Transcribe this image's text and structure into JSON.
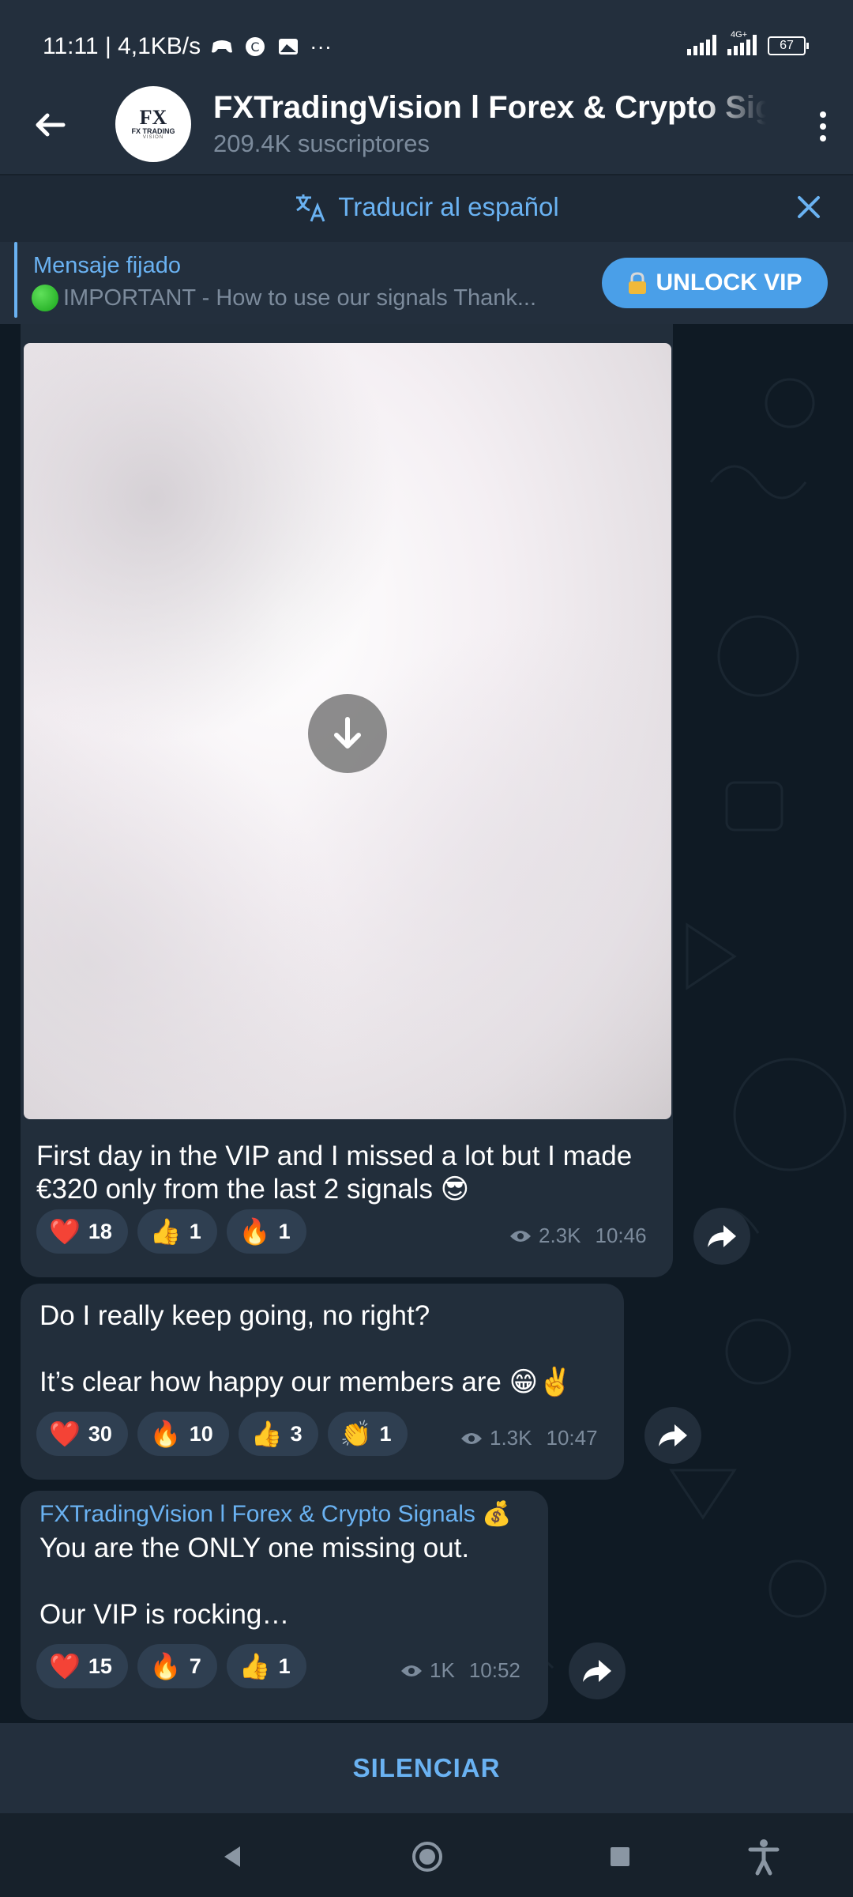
{
  "status_bar": {
    "left_text": "11:11 | 4,1KB/s",
    "network_label": "4G+",
    "battery": "67"
  },
  "header": {
    "title": "FXTradingVision l Forex & Crypto Signals",
    "subtitle": "209.4K suscriptores",
    "avatar_logo_mark": "FX",
    "avatar_logo_text": "FX TRADING",
    "avatar_logo_sub": "VISION"
  },
  "translate_bar": {
    "label": "Traducir al español"
  },
  "pinned": {
    "title": "Mensaje fijado",
    "text": "IMPORTANT - How to use our signals  Thank...",
    "button_label": "UNLOCK VIP"
  },
  "messages": [
    {
      "text_lines": [
        "First day in the VIP and I missed a lot but I made",
        "€320 only from the last 2 signals 😎"
      ],
      "reactions": [
        {
          "emoji": "❤️",
          "count": "18"
        },
        {
          "emoji": "👍",
          "count": "1"
        },
        {
          "emoji": "🔥",
          "count": "1"
        }
      ],
      "views": "2.3K",
      "time": "10:46"
    },
    {
      "text_lines": [
        "Do I really keep going, no right?",
        "",
        "It’s clear how happy our members are 😁✌️"
      ],
      "reactions": [
        {
          "emoji": "❤️",
          "count": "30"
        },
        {
          "emoji": "🔥",
          "count": "10"
        },
        {
          "emoji": "👍",
          "count": "3"
        },
        {
          "emoji": "👏",
          "count": "1"
        }
      ],
      "views": "1.3K",
      "time": "10:47"
    },
    {
      "sender": "FXTradingVision l Forex & Crypto Signals 💰",
      "text_lines": [
        "You are the ONLY one missing out.",
        "",
        "Our VIP is rocking…"
      ],
      "reactions": [
        {
          "emoji": "❤️",
          "count": "15"
        },
        {
          "emoji": "🔥",
          "count": "7"
        },
        {
          "emoji": "👍",
          "count": "1"
        }
      ],
      "views": "1K",
      "time": "10:52"
    }
  ],
  "bottom_bar": {
    "mute_label": "SILENCIAR"
  },
  "colors": {
    "accent": "#6ab2f2",
    "bubble": "#222e3b",
    "background": "#0f1a24",
    "header": "#232f3d",
    "button": "#4a9fe8"
  },
  "icons": {
    "back": "arrow-left-icon",
    "menu": "more-vertical-icon",
    "translate": "translate-icon",
    "close": "close-icon",
    "lock": "lock-icon",
    "download": "download-arrow-icon",
    "share": "share-forward-icon",
    "views": "eye-icon"
  }
}
